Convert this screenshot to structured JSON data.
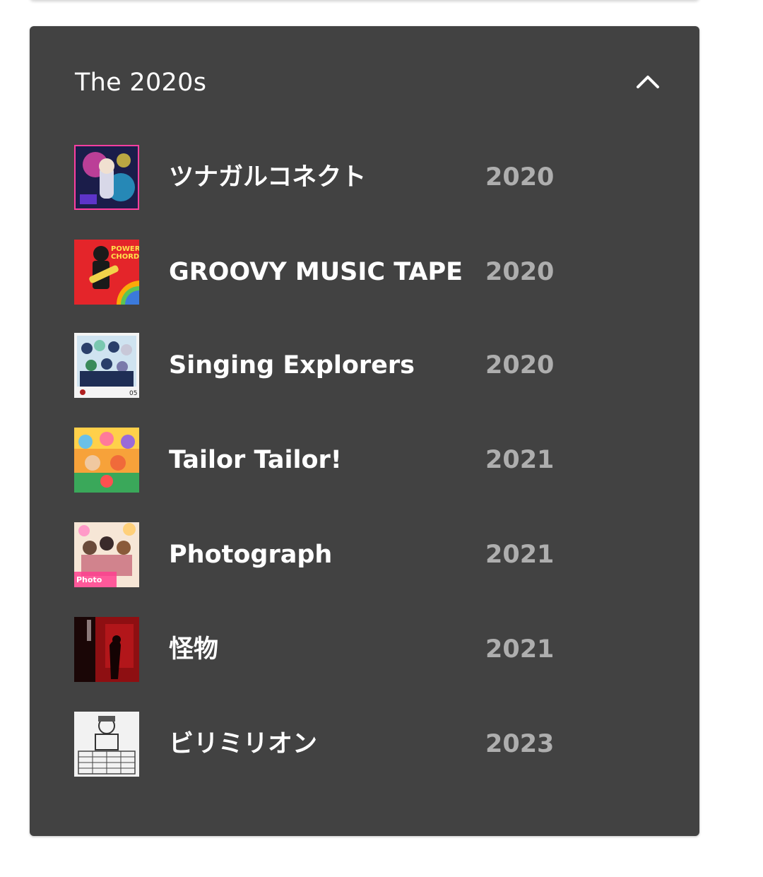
{
  "section": {
    "title": "The 2020s",
    "toggle_icon": "chevron-up-icon",
    "background": "#424242"
  },
  "albums": [
    {
      "title": "ツナガルコネクト",
      "year": "2020"
    },
    {
      "title": "GROOVY MUSIC TAPE",
      "year": "2020"
    },
    {
      "title": "Singing Explorers",
      "year": "2020"
    },
    {
      "title": "Tailor Tailor!",
      "year": "2021"
    },
    {
      "title": "Photograph",
      "year": "2021"
    },
    {
      "title": "怪物",
      "year": "2021"
    },
    {
      "title": "ビリミリオン",
      "year": "2023"
    }
  ],
  "colors": {
    "title_text": "#ffffff",
    "year_text": "#aeaeae"
  }
}
